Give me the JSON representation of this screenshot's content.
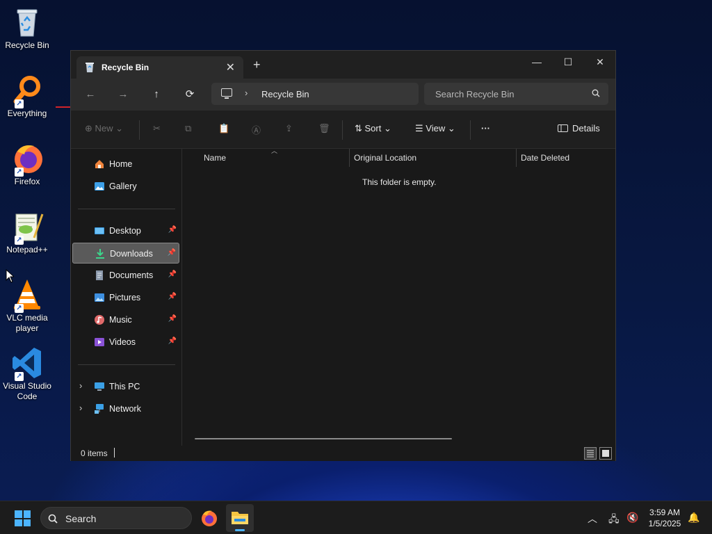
{
  "desktop": {
    "icons": [
      {
        "label": "Recycle Bin",
        "icon": "recycle-bin-icon"
      },
      {
        "label": "Everything",
        "icon": "everything-search-icon"
      },
      {
        "label": "Firefox",
        "icon": "firefox-icon"
      },
      {
        "label": "Notepad++",
        "icon": "notepad-plus-plus-icon"
      },
      {
        "label": "VLC media player",
        "icon": "vlc-icon"
      },
      {
        "label": "Visual Studio Code",
        "icon": "vscode-icon"
      }
    ]
  },
  "window": {
    "tab_title": "Recycle Bin",
    "new_tab": "+",
    "controls": {
      "minimize": "—",
      "maximize": "☐",
      "close": "✕"
    },
    "address": {
      "crumb": "Recycle Bin"
    },
    "search_placeholder": "Search Recycle Bin",
    "commands": {
      "new_label": "New",
      "sort_label": "Sort",
      "view_label": "View",
      "more_label": "···",
      "details_label": "Details"
    },
    "sidebar": {
      "home": "Home",
      "gallery": "Gallery",
      "desktop": "Desktop",
      "downloads": "Downloads",
      "documents": "Documents",
      "pictures": "Pictures",
      "music": "Music",
      "videos": "Videos",
      "this_pc": "This PC",
      "network": "Network"
    },
    "columns": {
      "name": "Name",
      "original_location": "Original Location",
      "date_deleted": "Date Deleted"
    },
    "empty_message": "This folder is empty.",
    "status": {
      "item_count": "0 items"
    }
  },
  "taskbar": {
    "search_label": "Search",
    "time": "3:59 AM",
    "date": "1/5/2025"
  },
  "colors": {
    "accent": "#4cb4ff",
    "window_bg": "#191919",
    "selected_bg": "#5a5a5a"
  }
}
